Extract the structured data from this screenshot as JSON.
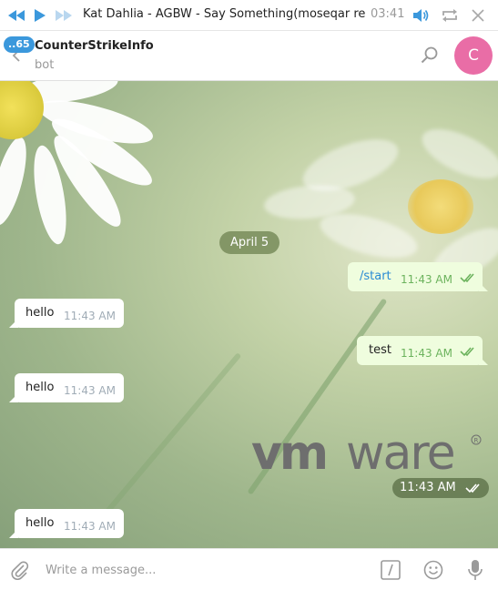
{
  "player": {
    "track_title": "Kat Dahlia - AGBW - Say Something(moseqar rem...",
    "time": "03:41",
    "icons": [
      "rewind-icon",
      "play-icon",
      "fast-forward-icon",
      "volume-icon",
      "repeat-icon",
      "close-icon"
    ],
    "accent_color": "#3b98dc"
  },
  "header": {
    "unread_badge": "..65",
    "chat_name": "CounterStrikeInfo",
    "status": "bot",
    "avatar_letter": "C",
    "avatar_color": "#e96da6"
  },
  "chat": {
    "date_separator": "April 5",
    "messages": [
      {
        "direction": "out",
        "text": "/start",
        "time": "11:43 AM",
        "read": true
      },
      {
        "direction": "in",
        "text": "hello",
        "time": "11:43 AM"
      },
      {
        "direction": "out",
        "text": "test",
        "time": "11:43 AM",
        "read": true
      },
      {
        "direction": "in",
        "text": "hello",
        "time": "11:43 AM"
      },
      {
        "direction": "out",
        "type": "image",
        "image_logo": "vmware",
        "time": "11:43 AM",
        "read": true
      },
      {
        "direction": "in",
        "text": "hello",
        "time": "11:43 AM"
      }
    ]
  },
  "composer": {
    "placeholder": "Write a message...",
    "icons": [
      "attach-icon",
      "bot-command-icon",
      "emoji-icon",
      "microphone-icon"
    ]
  }
}
